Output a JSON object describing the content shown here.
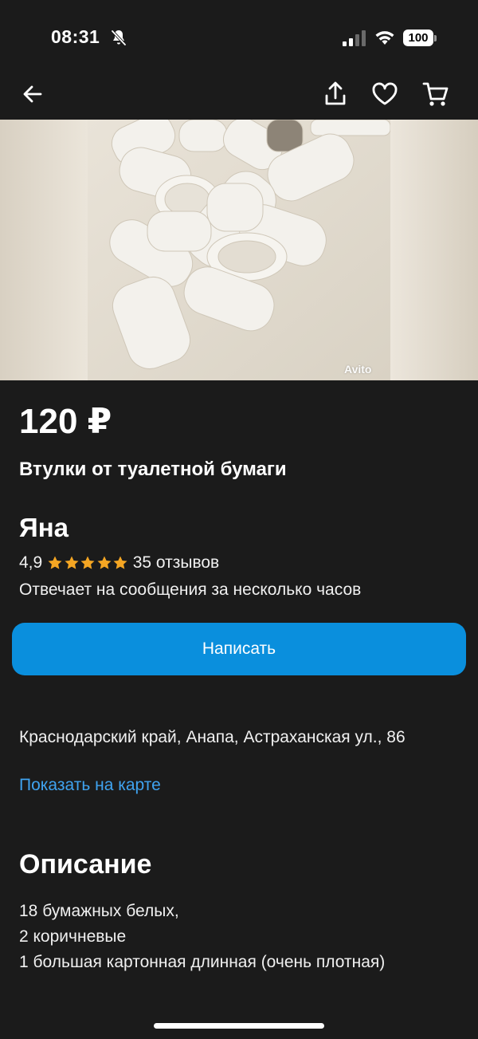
{
  "status_bar": {
    "time": "08:31",
    "battery": "100",
    "icons": [
      "bell-slash-icon",
      "signal-icon",
      "wifi-icon",
      "battery-icon"
    ]
  },
  "nav": {
    "icons": [
      "back-arrow-icon",
      "share-icon",
      "heart-icon",
      "cart-icon"
    ]
  },
  "photo": {
    "watermark": "Avito"
  },
  "listing": {
    "price": "120 ₽",
    "title": "Втулки от туалетной бумаги"
  },
  "seller": {
    "name": "Яна",
    "rating": "4,9",
    "stars": 5,
    "reviews": "35 отзывов",
    "response": "Отвечает на сообщения за несколько часов"
  },
  "actions": {
    "write_label": "Написать"
  },
  "location": {
    "address": "Краснодарский край, Анапа, Астраханская ул., 86",
    "map_link": "Показать на карте"
  },
  "description": {
    "heading": "Описание",
    "lines": [
      "18 бумажных белых,",
      "2 коричневые",
      "1 большая картонная длинная (очень плотная)"
    ]
  },
  "colors": {
    "background": "#1b1b1b",
    "accent_button": "#0a8fdd",
    "link": "#3fa3f0",
    "star": "#f5a623"
  }
}
